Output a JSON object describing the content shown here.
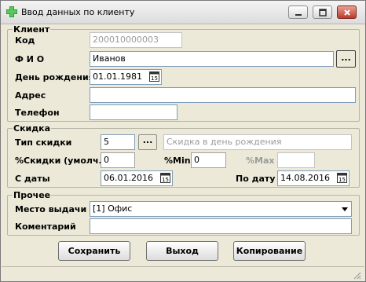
{
  "window": {
    "title": "Ввод данных по клиенту",
    "minimize_icon": "minimize-icon",
    "maximize_icon": "maximize-icon",
    "close_icon": "close-icon"
  },
  "client": {
    "legend": "Клиент",
    "code_label": "Код",
    "code_value": "200010000003",
    "fio_label": "Ф И О",
    "fio_value": "Иванов",
    "fio_button": "...",
    "birthday_label": "День рождения",
    "birthday_value": "01.01.1981",
    "address_label": "Адрес",
    "address_value": "",
    "phone_label": "Телефон",
    "phone_value": ""
  },
  "discount": {
    "legend": "Скидка",
    "type_label": "Тип скидки",
    "type_value": "5",
    "type_button": "...",
    "type_name": "Скидка в день рождения",
    "default_label": "%Скидки (умолч.)",
    "default_value": "0",
    "min_label": "%Min",
    "min_value": "0",
    "max_label": "%Max",
    "max_value": "",
    "from_label": "С даты",
    "from_value": "06.01.2016",
    "to_label": "По дату",
    "to_value": "14.08.2016"
  },
  "other": {
    "legend": "Прочее",
    "place_label": "Место выдачи",
    "place_value": "[1] Офис",
    "comment_label": "Коментарий",
    "comment_value": ""
  },
  "buttons": {
    "save": "Сохранить",
    "exit": "Выход",
    "copy": "Копирование"
  },
  "colors": {
    "window_bg": "#ece9d8",
    "app_icon": "#2e9e2e",
    "close_button": "#c0392b"
  }
}
